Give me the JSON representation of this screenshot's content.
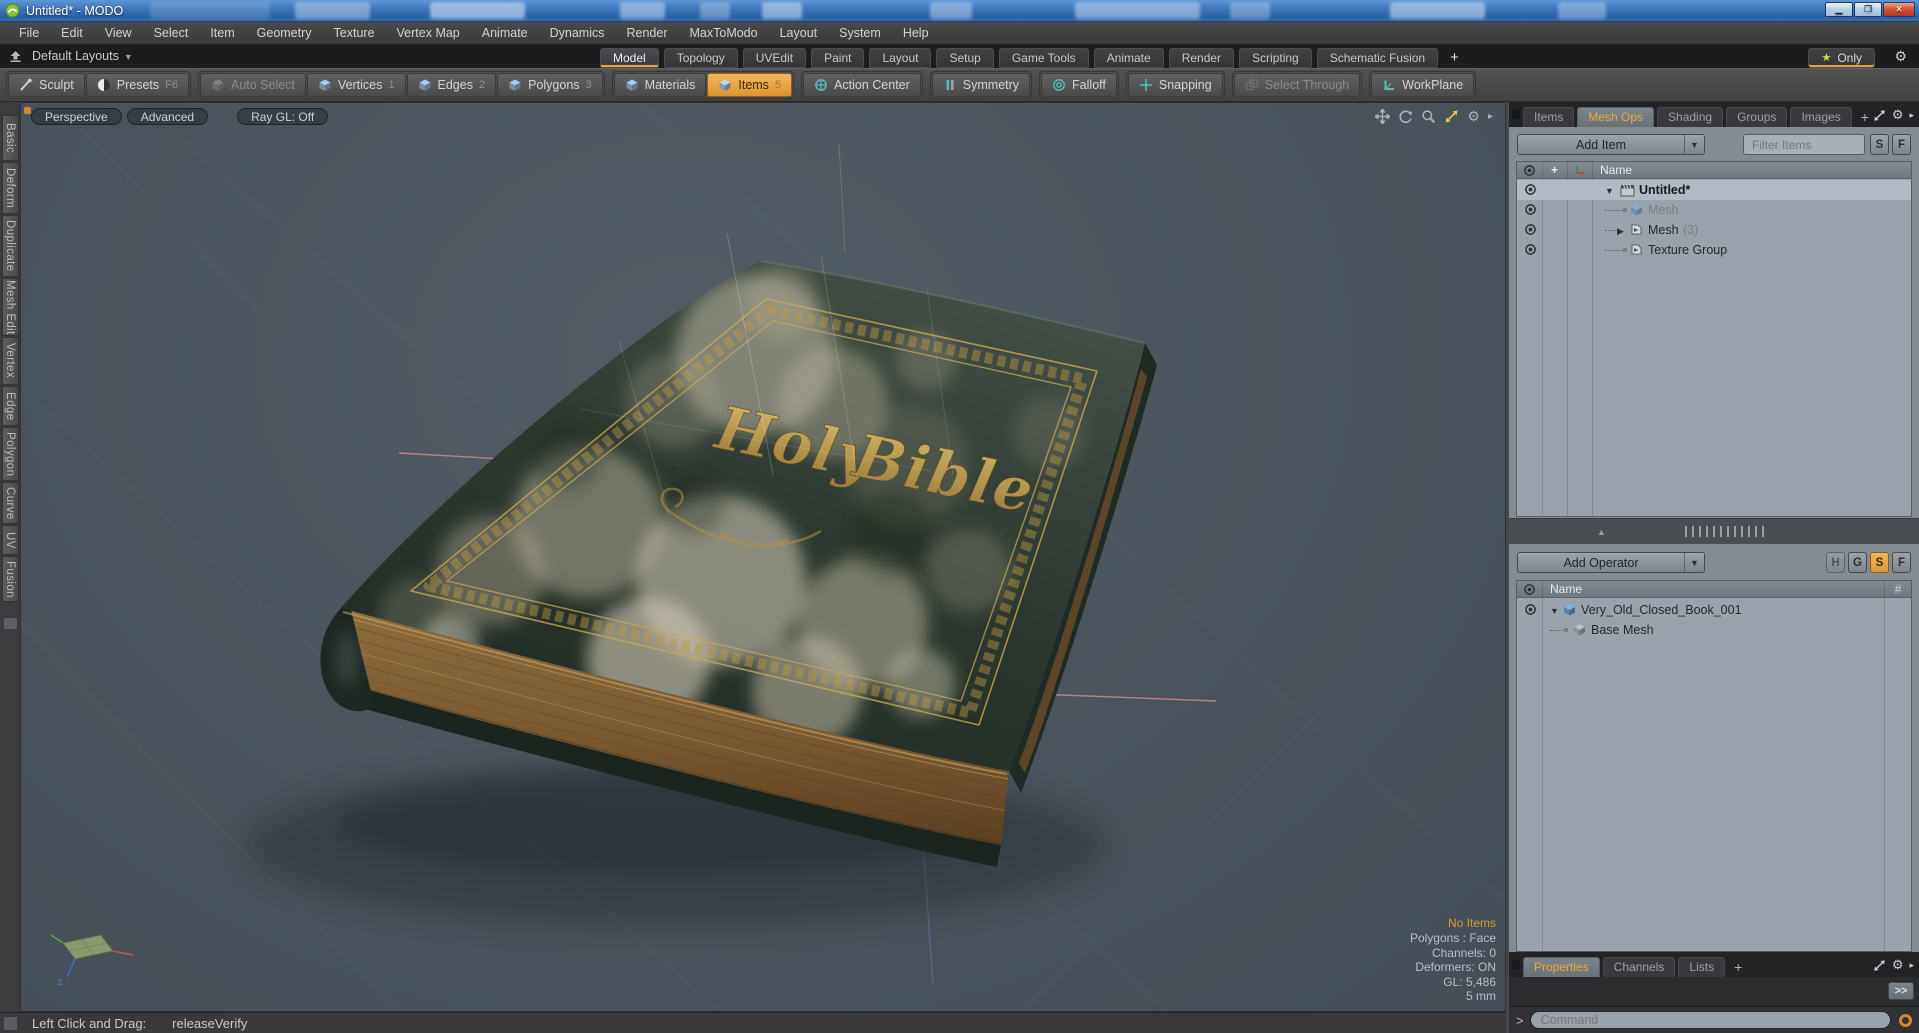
{
  "window": {
    "title": "Untitled* - MODO"
  },
  "menu_bar": {
    "items": [
      "File",
      "Edit",
      "View",
      "Select",
      "Item",
      "Geometry",
      "Texture",
      "Vertex Map",
      "Animate",
      "Dynamics",
      "Render",
      "MaxToModo",
      "Layout",
      "System",
      "Help"
    ]
  },
  "layout_bar": {
    "switcher": "Default Layouts",
    "tabs": [
      "Model",
      "Topology",
      "UVEdit",
      "Paint",
      "Layout",
      "Setup",
      "Game Tools",
      "Animate",
      "Render",
      "Scripting",
      "Schematic Fusion"
    ],
    "add_tab": "+",
    "favorites": "Only"
  },
  "toolbar": {
    "sculpt": "Sculpt",
    "presets": "Presets",
    "presets_key": "F6",
    "auto_select": "Auto Select",
    "vertices": "Vertices",
    "vertices_key": "1",
    "edges": "Edges",
    "edges_key": "2",
    "polygons": "Polygons",
    "polygons_key": "3",
    "materials": "Materials",
    "items": "Items",
    "items_key": "5",
    "action_center": "Action Center",
    "symmetry": "Symmetry",
    "falloff": "Falloff",
    "snapping": "Snapping",
    "select_through": "Select Through",
    "workplane": "WorkPlane"
  },
  "left_tabs": {
    "items": [
      "Basic",
      "Deform",
      "Duplicate",
      "Mesh Edit",
      "Vertex",
      "Edge",
      "Polygon",
      "Curve",
      "UV",
      "Fusion"
    ]
  },
  "viewport": {
    "buttons": [
      "Perspective",
      "Advanced",
      "Ray GL: Off"
    ],
    "book": {
      "word1": "Holy",
      "word2": "Bible"
    },
    "stats": {
      "selection": "No Items",
      "mode": "Polygons : Face",
      "channels": "Channels: 0",
      "deformers": "Deformers: ON",
      "gl": "GL: 5,486",
      "scale": "5 mm"
    },
    "gizmo_z": "z"
  },
  "right_panel": {
    "tabs": [
      "Items",
      "Mesh Ops",
      "Shading",
      "Groups",
      "Images"
    ],
    "add_tab": "+",
    "mesh_ops": {
      "add_item": "Add Item",
      "filter": "Filter Items",
      "btn_s": "S",
      "btn_f": "F",
      "col_name": "Name",
      "rows": [
        {
          "name": "Untitled*"
        },
        {
          "name": "Mesh"
        },
        {
          "name": "Mesh",
          "count": "(3)"
        },
        {
          "name": "Texture Group"
        }
      ]
    },
    "operators": {
      "add_operator": "Add Operator",
      "btn_h": "H",
      "btn_g": "G",
      "btn_s": "S",
      "btn_f": "F",
      "col_name": "Name",
      "col_hash": "#",
      "rows": [
        {
          "name": "Very_Old_Closed_Book_001"
        },
        {
          "name": "Base Mesh"
        }
      ]
    },
    "bottom_tabs": [
      "Properties",
      "Channels",
      "Lists"
    ],
    "bottom_add_tab": "+",
    "expand": ">>"
  },
  "command_bar": {
    "prompt": ">",
    "placeholder": "Command"
  },
  "status_bar": {
    "hint": "Left Click and Drag:",
    "value": "releaseVerify"
  },
  "colors": {
    "accent": "#e8a33d",
    "teal": "#4cc0b6",
    "viewport_bg": "#4d565e",
    "cover_green": "#26322a",
    "gold": "#c2a254"
  }
}
